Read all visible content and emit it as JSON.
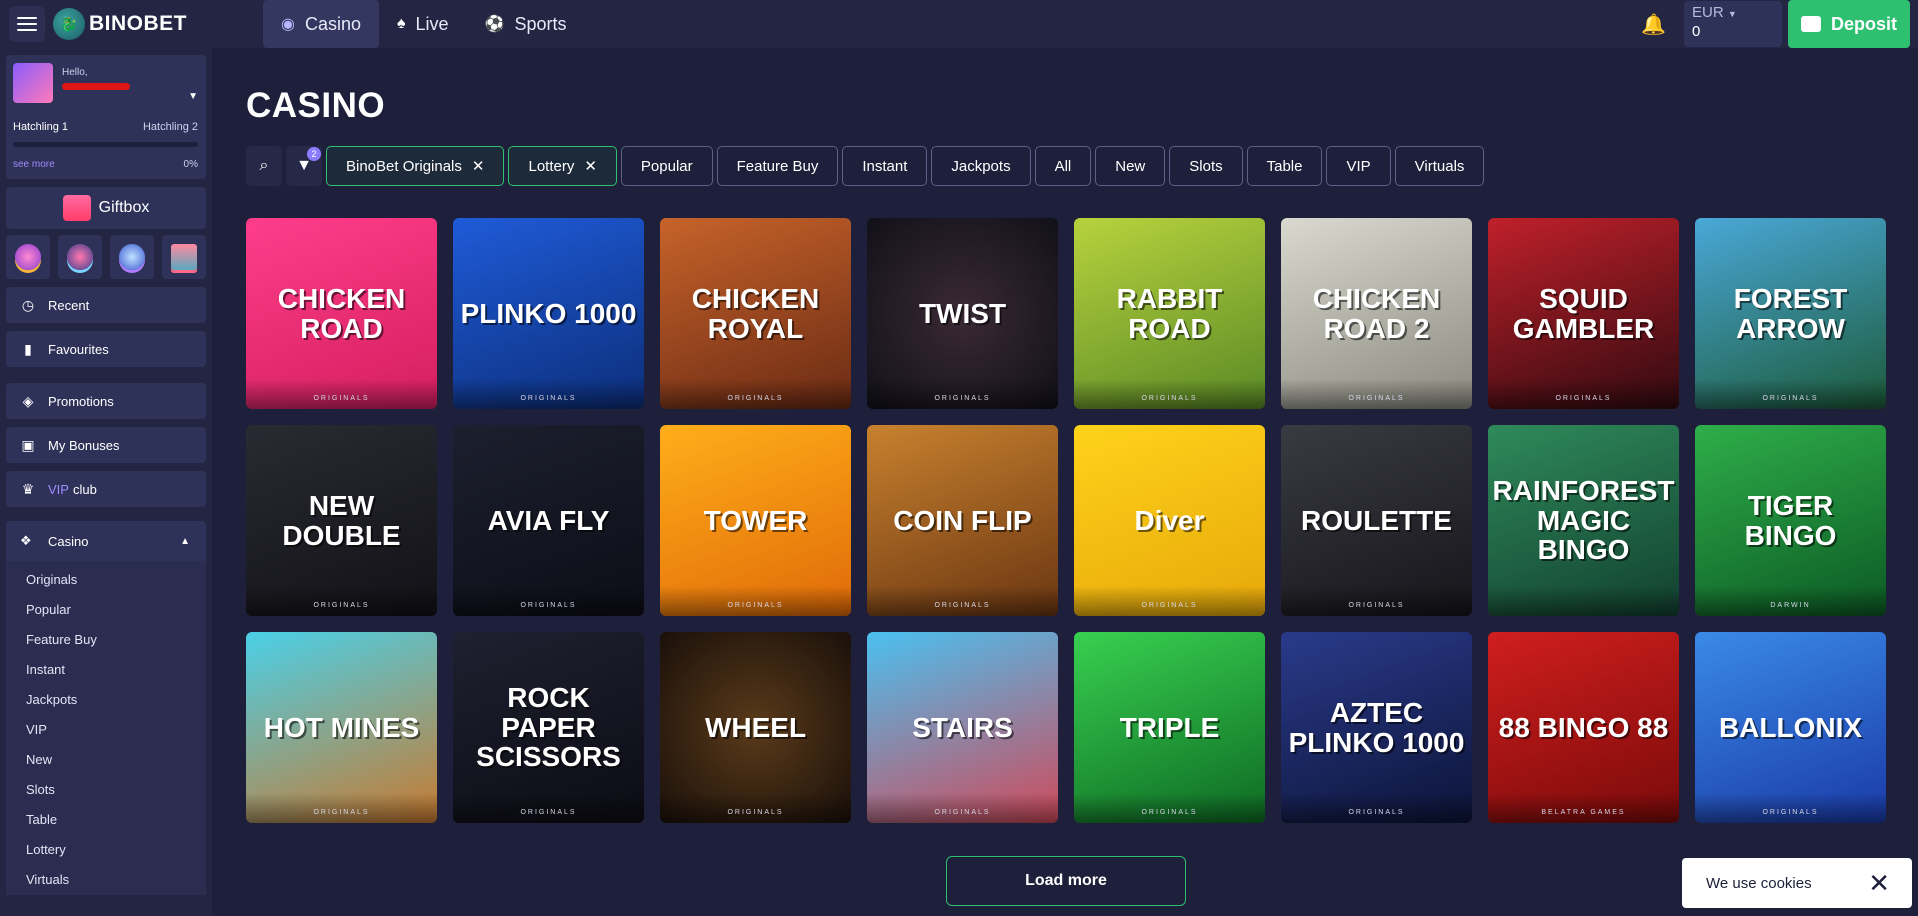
{
  "header": {
    "logo_text": "BINOBET",
    "nav": [
      {
        "label": "Casino",
        "icon": "casino-chip-icon"
      },
      {
        "label": "Live",
        "icon": "live-card-icon"
      },
      {
        "label": "Sports",
        "icon": "sports-ball-icon"
      }
    ],
    "currency": "EUR",
    "balance": "0",
    "deposit_label": "Deposit"
  },
  "sidebar": {
    "profile": {
      "hello": "Hello,",
      "level_current": "Hatchling 1",
      "level_next": "Hatchling 2",
      "see_more": "see more",
      "progress_label": "0%",
      "progress": 0
    },
    "giftbox_label": "Giftbox",
    "quick_icons": [
      {
        "icon": "slots-icon",
        "accent": "#f5b53d"
      },
      {
        "icon": "rocket-icon",
        "accent": "#7ad2ff"
      },
      {
        "icon": "trophy-icon",
        "accent": "#b07bff"
      },
      {
        "icon": "shop-icon",
        "accent": "#ff6a8a"
      }
    ],
    "menu": [
      {
        "label": "Recent",
        "icon": "clock-icon"
      },
      {
        "label": "Favourites",
        "icon": "bookmark-icon"
      },
      {
        "label": "Promotions",
        "icon": "promotions-icon"
      },
      {
        "label": "My Bonuses",
        "icon": "gift-icon"
      }
    ],
    "vip": {
      "prefix": "VIP",
      "suffix": "club"
    },
    "casino_section": {
      "label": "Casino",
      "items": [
        "Originals",
        "Popular",
        "Feature Buy",
        "Instant",
        "Jackpots",
        "VIP",
        "New",
        "Slots",
        "Table",
        "Lottery",
        "Virtuals"
      ]
    }
  },
  "main": {
    "title": "CASINO",
    "filter_badge": "2",
    "selected_filters": [
      "BinoBet Originals",
      "Lottery"
    ],
    "filters": [
      "Popular",
      "Feature Buy",
      "Instant",
      "Jackpots",
      "All",
      "New",
      "Slots",
      "Table",
      "VIP",
      "Virtuals"
    ],
    "games": [
      {
        "title": "CHICKEN ROAD",
        "footer": "ORIGINALS",
        "bg": "linear-gradient(160deg,#ff3d8b,#d41f5e)"
      },
      {
        "title": "PLINKO 1000",
        "footer": "ORIGINALS",
        "bg": "linear-gradient(160deg,#1f5bd8,#0c2e7a)"
      },
      {
        "title": "CHICKEN ROYAL",
        "footer": "ORIGINALS",
        "bg": "linear-gradient(160deg,#c7632a,#6a2a14)"
      },
      {
        "title": "TWIST",
        "footer": "ORIGINALS",
        "bg": "radial-gradient(circle,#3a2a35,#111018)"
      },
      {
        "title": "RABBIT ROAD",
        "footer": "ORIGINALS",
        "bg": "linear-gradient(160deg,#b7d23d,#5a8a26)"
      },
      {
        "title": "CHICKEN ROAD 2",
        "footer": "ORIGINALS",
        "bg": "linear-gradient(160deg,#d9d9d0,#8a8a80)"
      },
      {
        "title": "SQUID GAMBLER",
        "footer": "ORIGINALS",
        "bg": "linear-gradient(160deg,#c0202a,#300a10)"
      },
      {
        "title": "FOREST ARROW",
        "footer": "ORIGINALS",
        "bg": "linear-gradient(160deg,#4aa8d8,#1c5a3a)"
      },
      {
        "title": "NEW DOUBLE",
        "footer": "ORIGINALS",
        "bg": "linear-gradient(160deg,#2a2a33,#111116)"
      },
      {
        "title": "AVIA FLY",
        "footer": "ORIGINALS",
        "bg": "linear-gradient(160deg,#1c1f2e,#0c0d16)"
      },
      {
        "title": "TOWER",
        "footer": "ORIGINALS",
        "bg": "linear-gradient(160deg,#ffae1a,#e06a08)"
      },
      {
        "title": "COIN FLIP",
        "footer": "ORIGINALS",
        "bg": "linear-gradient(160deg,#c8812e,#6a3612)"
      },
      {
        "title": "Diver",
        "footer": "ORIGINALS",
        "bg": "linear-gradient(160deg,#ffd21a,#e6a80a)"
      },
      {
        "title": "ROULETTE",
        "footer": "ORIGINALS",
        "bg": "linear-gradient(160deg,#3a3a42,#15151a)"
      },
      {
        "title": "RAINFOREST MAGIC BINGO",
        "footer": "",
        "bg": "linear-gradient(160deg,#2f8a5a,#124030)"
      },
      {
        "title": "TIGER BINGO",
        "footer": "DARWIN",
        "bg": "linear-gradient(160deg,#2fae4a,#0c5a24)"
      },
      {
        "title": "HOT MINES",
        "footer": "ORIGINALS",
        "bg": "linear-gradient(160deg,#4ad0e8,#c87a30)"
      },
      {
        "title": "ROCK PAPER SCISSORS",
        "footer": "ORIGINALS",
        "bg": "linear-gradient(160deg,#1f2030,#0c0c14)"
      },
      {
        "title": "WHEEL",
        "footer": "ORIGINALS",
        "bg": "radial-gradient(circle,#5a3a1a,#1a100a)"
      },
      {
        "title": "STAIRS",
        "footer": "ORIGINALS",
        "bg": "linear-gradient(160deg,#4ac0f0,#d04a5a)"
      },
      {
        "title": "TRIPLE",
        "footer": "ORIGINALS",
        "bg": "linear-gradient(160deg,#38d050,#0e6a24)"
      },
      {
        "title": "AZTEC PLINKO 1000",
        "footer": "ORIGINALS",
        "bg": "linear-gradient(160deg,#2a3a8a,#0c1438)"
      },
      {
        "title": "88 BINGO 88",
        "footer": "BELATRA GAMES",
        "bg": "linear-gradient(160deg,#d01e1e,#7a0a0a)"
      },
      {
        "title": "BALLONIX",
        "footer": "ORIGINALS",
        "bg": "linear-gradient(160deg,#3a8ae8,#1a3aa8)"
      }
    ],
    "load_more": "Load more"
  },
  "cookies": {
    "text": "We use cookies"
  }
}
